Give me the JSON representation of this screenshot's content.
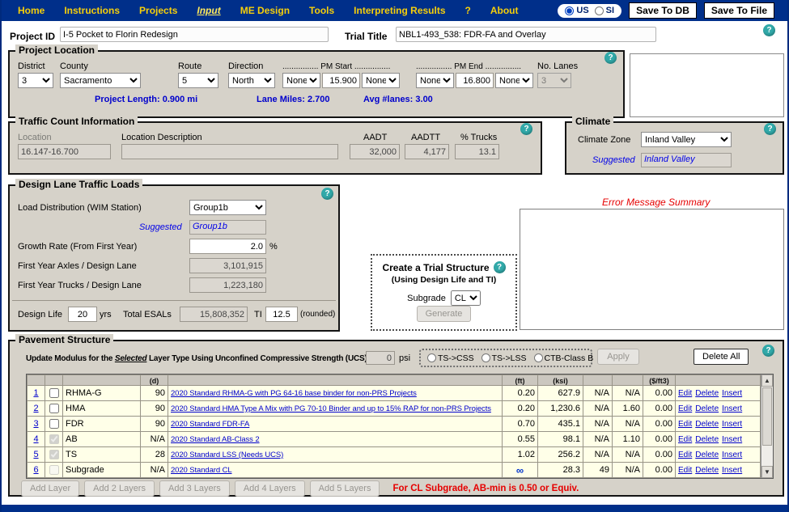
{
  "colors": {
    "nav_blue": "#002f8a",
    "nav_yellow": "#f6cf0a",
    "help_teal": "#31a9a9",
    "link_blue": "#0000cc",
    "error_red": "#e60000",
    "panel_gray": "#d6d2c9",
    "row_cream": "#ffffe8"
  },
  "icons": {
    "help": "?",
    "scroll_up": "▲",
    "scroll_down": "▼"
  },
  "nav": {
    "items": [
      {
        "label": "Home"
      },
      {
        "label": "Instructions"
      },
      {
        "label": "Projects"
      },
      {
        "label": "Input",
        "active": true
      },
      {
        "label": "ME Design"
      },
      {
        "label": "Tools"
      },
      {
        "label": "Interpreting Results"
      },
      {
        "label": "?"
      },
      {
        "label": "About"
      }
    ],
    "units": {
      "us_label": "US",
      "si_label": "SI",
      "selected": "US"
    },
    "save_db_label": "Save To DB",
    "save_file_label": "Save To File"
  },
  "header": {
    "project_id_label": "Project ID",
    "project_id_value": "I-5 Pocket to Florin Redesign",
    "trial_title_label": "Trial Title",
    "trial_title_value": "NBL1-493_538: FDR-FA and Overlay"
  },
  "project_location": {
    "legend": "Project Location",
    "district_label": "District",
    "district_value": "3",
    "county_label": "County",
    "county_value": "Sacramento",
    "route_label": "Route",
    "route_value": "5",
    "direction_label": "Direction",
    "direction_value": "North",
    "pm_start_label": "................ PM Start ................",
    "pm_start_prefix": "None",
    "pm_start_value": "15.900",
    "pm_start_suffix": "None",
    "pm_end_label": "................ PM End ................",
    "pm_end_prefix": "None",
    "pm_end_value": "16.800",
    "pm_end_suffix": "None",
    "no_lanes_label": "No. Lanes",
    "no_lanes_value": "3",
    "project_length": "Project Length: 0.900 mi",
    "lane_miles": "Lane Miles: 2.700",
    "avg_lanes": "Avg #lanes: 3.00"
  },
  "traffic_count": {
    "legend": "Traffic Count Information",
    "location_label": "Location",
    "location_value": "16.147-16.700",
    "location_desc_label": "Location Description",
    "location_desc_value": "",
    "aadt_label": "AADT",
    "aadt_value": "32,000",
    "aadtt_label": "AADTT",
    "aadtt_value": "4,177",
    "trucks_label": "% Trucks",
    "trucks_value": "13.1"
  },
  "climate": {
    "legend": "Climate",
    "zone_label": "Climate Zone",
    "zone_value": "Inland Valley",
    "suggested_label": "Suggested",
    "suggested_value": "Inland Valley"
  },
  "design_loads": {
    "legend": "Design Lane Traffic Loads",
    "wim_label": "Load Distribution (WIM Station)",
    "wim_value": "Group1b",
    "suggested_label": "Suggested",
    "suggested_value": "Group1b",
    "growth_label": "Growth Rate (From First Year)",
    "growth_value": "2.0",
    "growth_unit": "%",
    "axles_label": "First Year Axles / Design Lane",
    "axles_value": "3,101,915",
    "trucks_label": "First Year Trucks / Design Lane",
    "trucks_value": "1,223,180",
    "design_life_label": "Design Life",
    "design_life_value": "20",
    "design_life_unit": "yrs",
    "esals_label": "Total ESALs",
    "esals_value": "15,808,352",
    "ti_label": "TI",
    "ti_value": "12.5",
    "ti_suffix": "(rounded)"
  },
  "trial_structure": {
    "title": "Create a Trial Structure",
    "subtitle": "(Using Design Life and TI)",
    "subgrade_label": "Subgrade",
    "subgrade_value": "CL",
    "generate_label": "Generate"
  },
  "error_summary": {
    "title": "Error Message Summary"
  },
  "pavement": {
    "legend": "Pavement Structure",
    "ucs_label_pre": "Update Modulus for the ",
    "ucs_label_em": "Selected",
    "ucs_label_post": " Layer Type Using Unconfined Compressive Strength (UCS):",
    "ucs_value": "0",
    "ucs_unit": "psi",
    "radio_options": [
      "TS->CSS",
      "TS->LSS",
      "CTB-Class B"
    ],
    "apply_label": "Apply",
    "delete_all_label": "Delete All",
    "header_partial": {
      "d": "(d)",
      "ft": "(ft)",
      "ksi": "(ksi)",
      "cost": "($/ft3)"
    },
    "row_actions": [
      "Edit",
      "Delete",
      "Insert"
    ],
    "rows": [
      {
        "num": "1",
        "checked": false,
        "cb_disabled": false,
        "layer": "RHMA-G",
        "d": "90",
        "material": "2020 Standard RHMA-G with PG 64-16 base binder for non-PRS Projects",
        "thickness": "0.20",
        "modulus": "627.9",
        "col8": "N/A",
        "col9": "N/A",
        "cost": "0.00"
      },
      {
        "num": "2",
        "checked": false,
        "cb_disabled": false,
        "layer": "HMA",
        "d": "90",
        "material": "2020 Standard HMA Type A Mix with PG 70-10 Binder and up to 15% RAP for non-PRS Projects",
        "thickness": "0.20",
        "modulus": "1,230.6",
        "col8": "N/A",
        "col9": "1.60",
        "cost": "0.00"
      },
      {
        "num": "3",
        "checked": false,
        "cb_disabled": false,
        "layer": "FDR",
        "d": "90",
        "material": "2020 Standard FDR-FA",
        "thickness": "0.70",
        "modulus": "435.1",
        "col8": "N/A",
        "col9": "N/A",
        "cost": "0.00"
      },
      {
        "num": "4",
        "checked": true,
        "cb_disabled": true,
        "layer": "AB",
        "d": "N/A",
        "material": "2020 Standard AB-Class 2",
        "thickness": "0.55",
        "modulus": "98.1",
        "col8": "N/A",
        "col9": "1.10",
        "cost": "0.00"
      },
      {
        "num": "5",
        "checked": true,
        "cb_disabled": true,
        "layer": "TS",
        "d": "28",
        "material": "2020 Standard LSS (Needs UCS)",
        "thickness": "1.02",
        "modulus": "256.2",
        "col8": "N/A",
        "col9": "N/A",
        "cost": "0.00"
      },
      {
        "num": "6",
        "checked": false,
        "cb_disabled": true,
        "layer": "Subgrade",
        "d": "N/A",
        "material": "2020 Standard CL",
        "thickness": "∞",
        "modulus": "28.3",
        "col8": "49",
        "col9": "N/A",
        "cost": "0.00"
      }
    ],
    "add_buttons": [
      "Add Layer",
      "Add 2 Layers",
      "Add 3 Layers",
      "Add 4 Layers",
      "Add 5 Layers"
    ],
    "note": "For CL Subgrade, AB-min is 0.50 or Equiv."
  }
}
